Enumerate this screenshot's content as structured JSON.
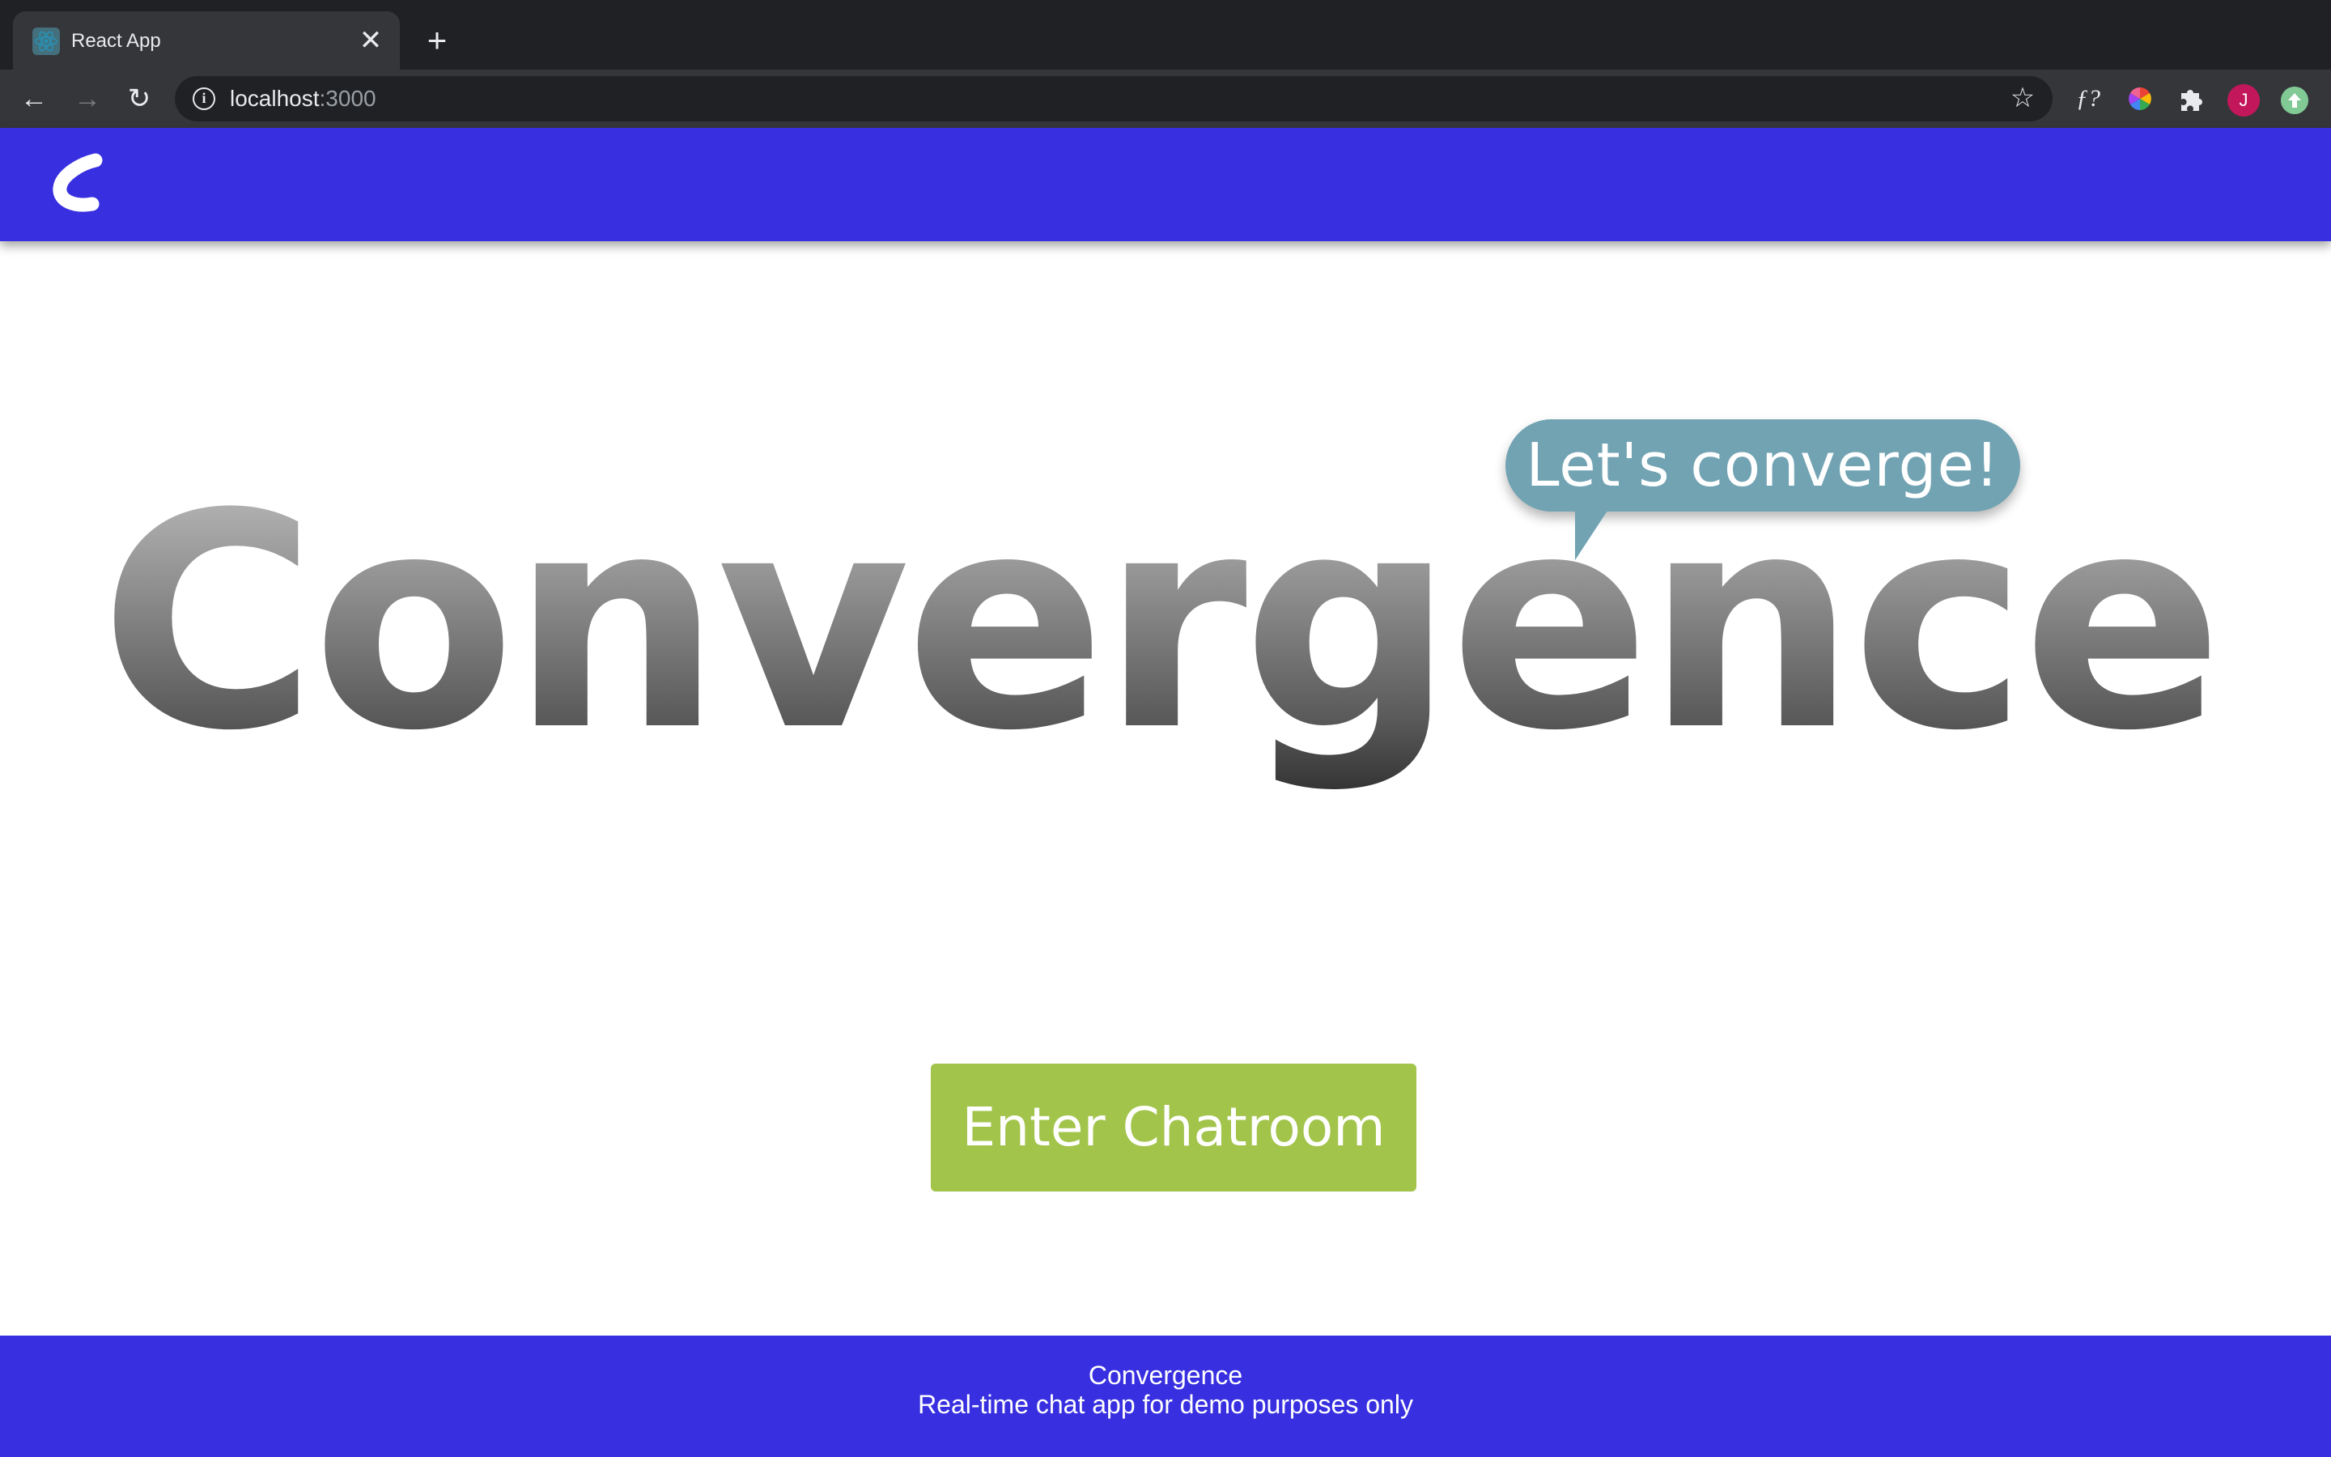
{
  "browser": {
    "tab": {
      "title": "React App",
      "favicon": "react-logo-icon"
    },
    "new_tab_symbol": "+",
    "close_symbol": "✕",
    "address": {
      "host": "localhost",
      "port": ":3000"
    },
    "nav": {
      "back": "←",
      "forward": "→",
      "reload": "↻"
    },
    "star": "☆",
    "extensions": [
      {
        "name": "font-identifier-icon",
        "text": "ƒ?"
      },
      {
        "name": "color-wheel-icon"
      },
      {
        "name": "puzzle-piece-icon"
      }
    ],
    "avatar_initial": "J",
    "update_icon": "update-arrow-icon",
    "colors": {
      "tabbar": "#202124",
      "toolbar": "#35363a",
      "avatar": "#c2185b"
    }
  },
  "header": {
    "logo": "convergence-c-logo",
    "color": "#3830e0"
  },
  "hero": {
    "title": "Convergence",
    "bubble_text": "Let's converge!",
    "bubble_color": "#71a3b3"
  },
  "cta": {
    "label": "Enter Chatroom",
    "color": "#a2c44b"
  },
  "footer": {
    "title": "Convergence",
    "subtitle": "Real-time chat app for demo purposes only",
    "color": "#3830e0"
  }
}
